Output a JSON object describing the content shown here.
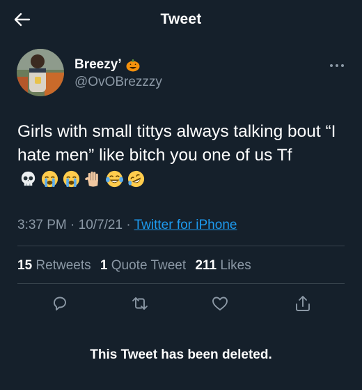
{
  "header": {
    "title": "Tweet"
  },
  "user": {
    "display_name": "Breezy’",
    "handle": "@OvOBrezzzy"
  },
  "tweet": {
    "text_before_emojis": "Girls with small tittys always talking bout “I hate men” like bitch you one of us Tf",
    "emojis": [
      "skull-emoji",
      "loudly-crying-face-emoji",
      "loudly-crying-face-emoji",
      "raised-hand-emoji",
      "tears-of-joy-emoji",
      "rolling-laughing-emoji"
    ],
    "time": "3:37 PM",
    "separator_1": "·",
    "date": "10/7/21",
    "separator_2": "·",
    "source": "Twitter for iPhone"
  },
  "stats": {
    "retweets_count": "15",
    "retweets_label": "Retweets",
    "quotes_count": "1",
    "quotes_label": "Quote Tweet",
    "likes_count": "211",
    "likes_label": "Likes"
  },
  "notice": "This Tweet has been deleted.",
  "colors": {
    "background": "#15202b",
    "link": "#1d9bf0",
    "secondary_text": "#8b98a5",
    "divider": "#38444d"
  },
  "icons": {
    "back": "arrow-left-icon",
    "more": "more-dots-icon",
    "reply": "reply-icon",
    "retweet": "retweet-icon",
    "like": "heart-icon",
    "share": "share-icon"
  }
}
